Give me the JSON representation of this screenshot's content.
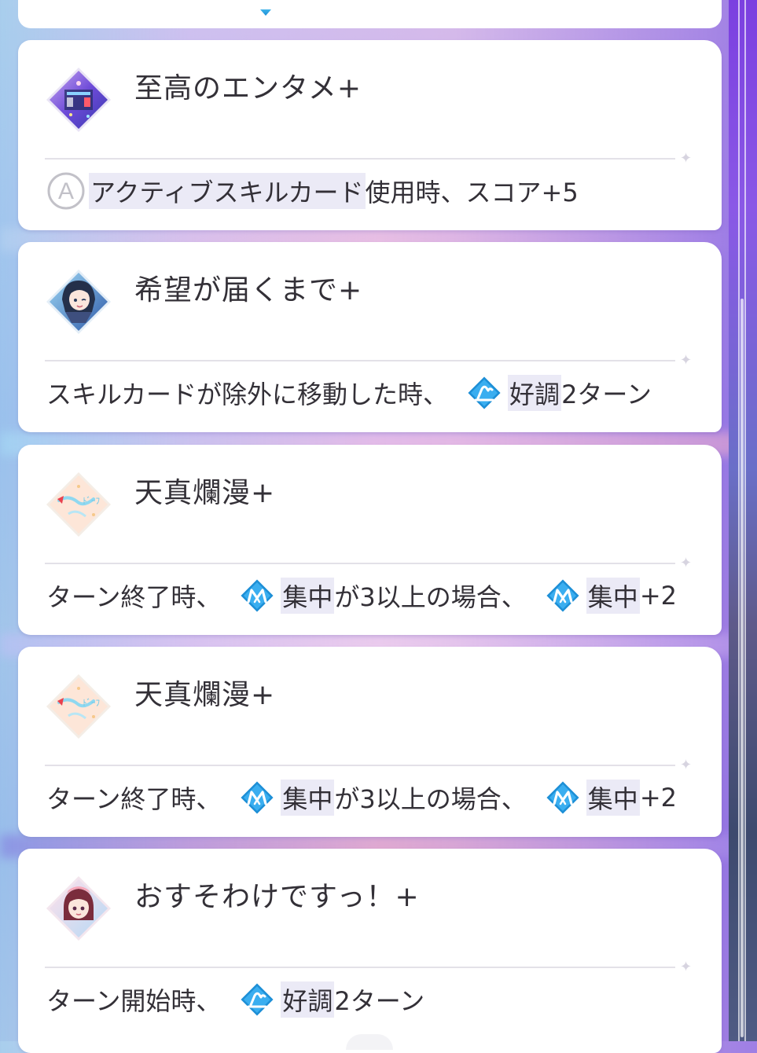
{
  "colors": {
    "card_background": "#ffffff",
    "text": "#333037",
    "highlight": "#ebeaf6",
    "status_icon_blue": "#1d8fd6",
    "frame_purple": "#7b3fe0"
  },
  "cards": [
    {
      "title": "至高のエンタメ+",
      "icon": "stage-illustration-icon",
      "description": {
        "type_icon": "active-skill-a-icon",
        "highlight": "アクティブスキルカード",
        "rest": "使用時、スコア+5"
      }
    },
    {
      "title": "希望が届くまで+",
      "icon": "idol-portrait-icon",
      "description": {
        "lead": "スキルカードが除外に移動した時、",
        "status_icon": "good-condition-icon",
        "highlight": "好調",
        "rest": "2ターン"
      }
    },
    {
      "title": "天真爛漫+",
      "icon": "ribbon-illustration-icon",
      "description": {
        "lead": "ターン終了時、",
        "status_icon_1": "concentration-icon",
        "highlight_1": "集中",
        "middle": "が3以上の場合、",
        "status_icon_2": "concentration-icon",
        "highlight_2": "集中",
        "rest": "+2"
      }
    },
    {
      "title": "天真爛漫+",
      "icon": "ribbon-illustration-icon",
      "description": {
        "lead": "ターン終了時、",
        "status_icon_1": "concentration-icon",
        "highlight_1": "集中",
        "middle": "が3以上の場合、",
        "status_icon_2": "concentration-icon",
        "highlight_2": "集中",
        "rest": "+2"
      }
    },
    {
      "title": "おすそわけですっ！+",
      "icon": "idol-portrait-icon",
      "description": {
        "lead": "ターン開始時、",
        "status_icon": "good-condition-icon",
        "highlight": "好調",
        "rest": "2ターン"
      }
    }
  ]
}
